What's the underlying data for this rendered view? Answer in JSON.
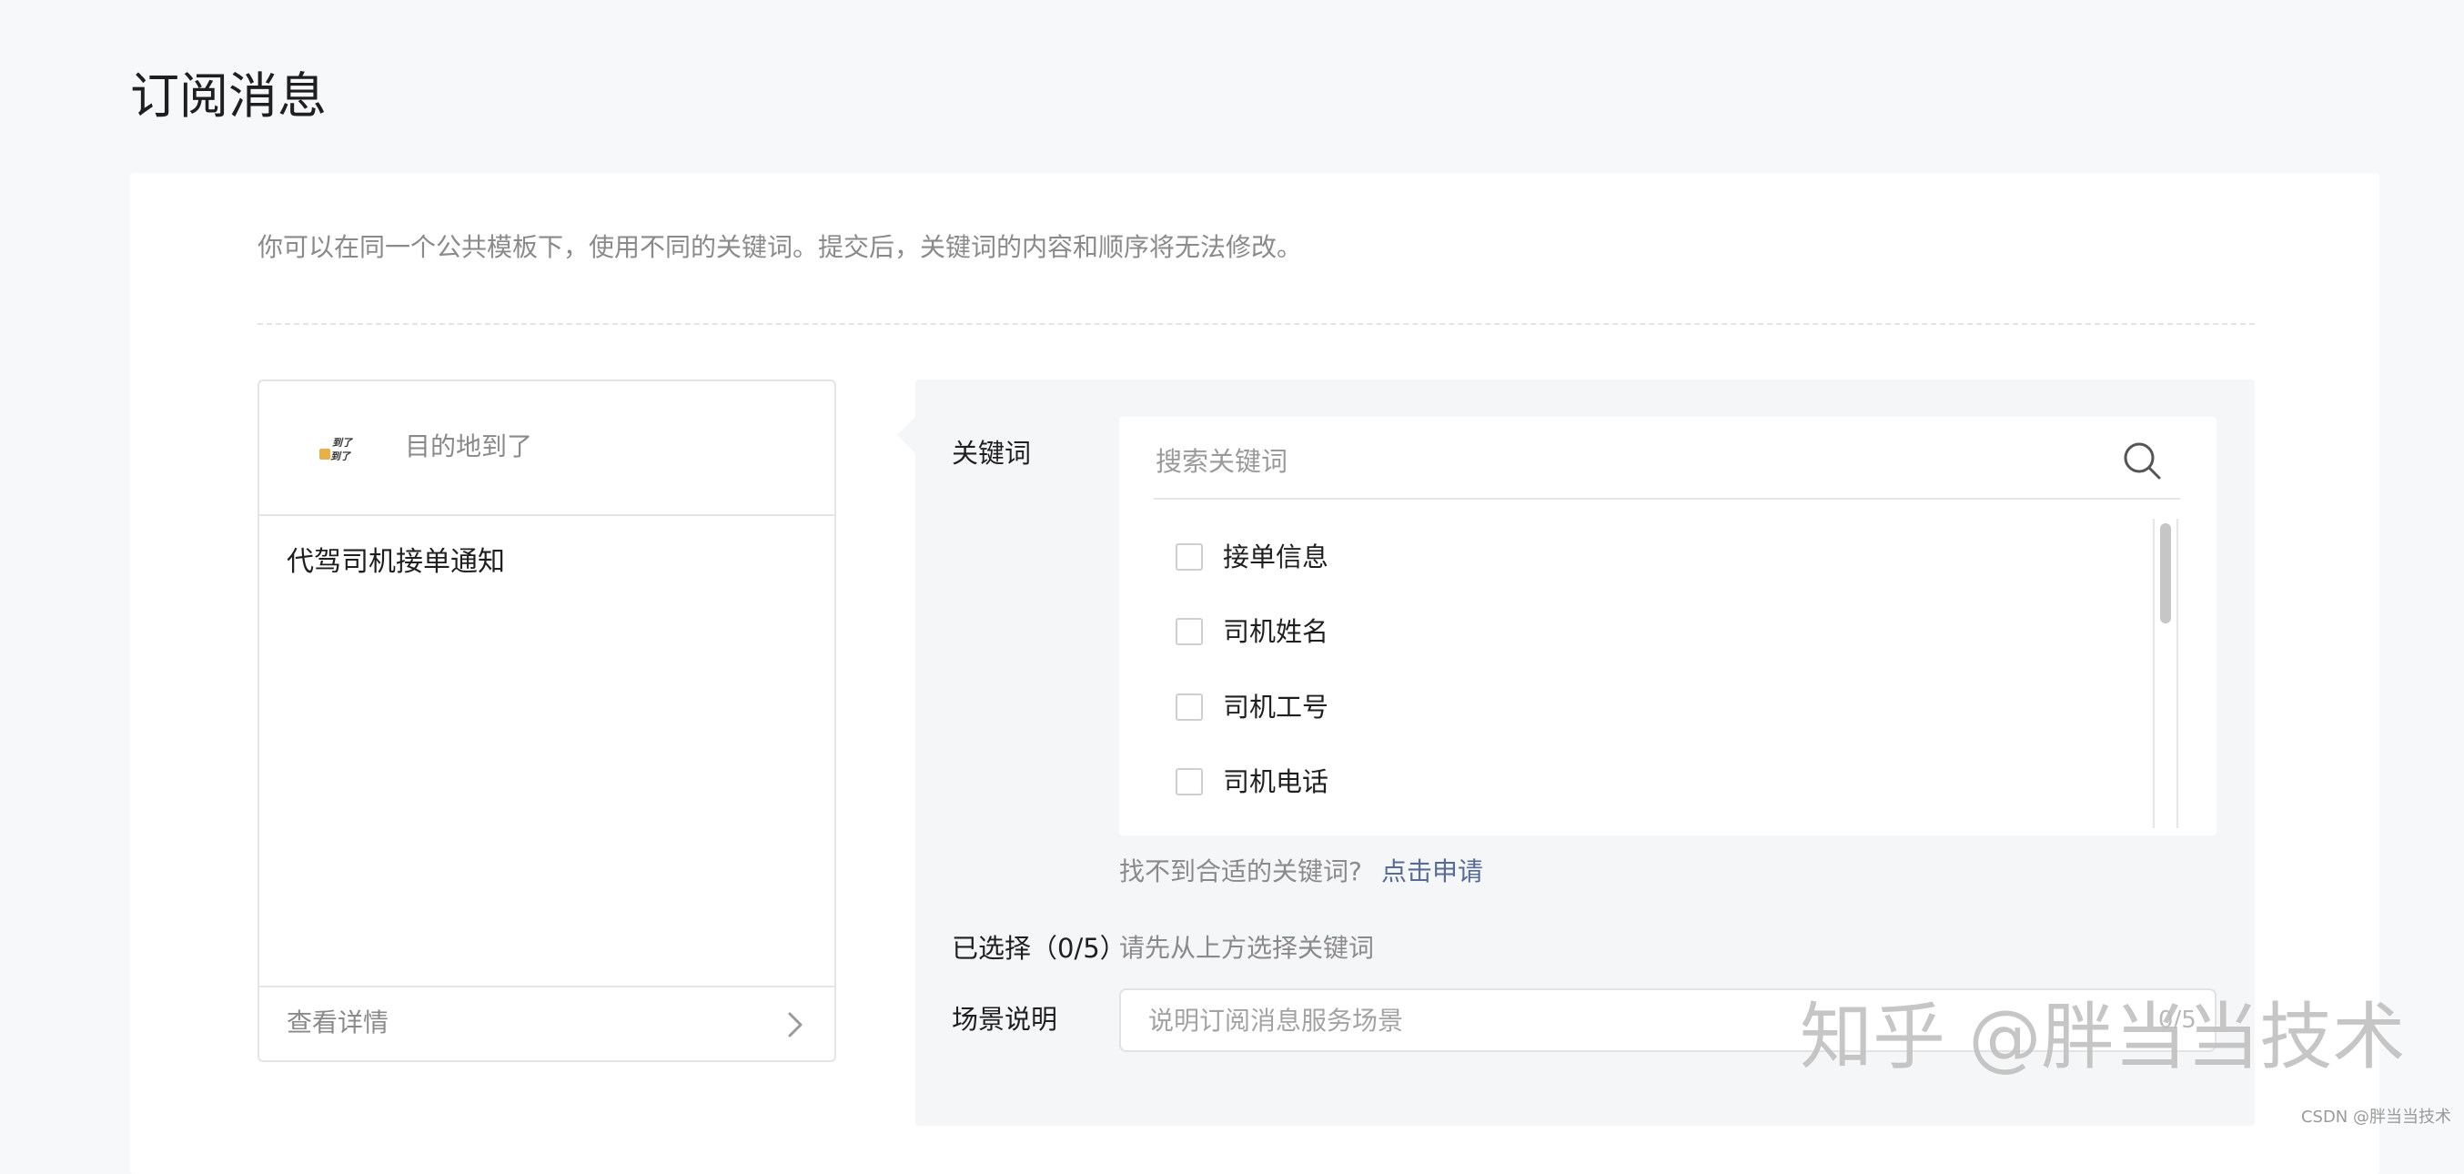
{
  "page": {
    "title": "订阅消息"
  },
  "notice": "你可以在同一个公共模板下，使用不同的关键词。提交后，关键词的内容和顺序将无法修改。",
  "preview": {
    "app_name": "目的地到了",
    "logo_text": "到了到了",
    "message_title": "代驾司机接单通知",
    "footer_label": "查看详情",
    "footer_icon": "chevron-right-icon"
  },
  "keywords": {
    "label": "关键词",
    "search_placeholder": "搜索关键词",
    "search_icon": "search-icon",
    "items": [
      {
        "label": "接单信息",
        "checked": false
      },
      {
        "label": "司机姓名",
        "checked": false
      },
      {
        "label": "司机工号",
        "checked": false
      },
      {
        "label": "司机电话",
        "checked": false
      }
    ],
    "hint": "找不到合适的关键词?",
    "apply_link": "点击申请"
  },
  "selected": {
    "label": "已选择（0/5）",
    "hint": "请先从上方选择关键词"
  },
  "scene": {
    "label": "场景说明",
    "placeholder": "说明订阅消息服务场景",
    "count": "0/5"
  },
  "watermark": "知乎 @胖当当技术",
  "credit": "CSDN @胖当当技术",
  "colors": {
    "background": "#f7f8fa",
    "card": "#ffffff",
    "panel": "#f5f6f7",
    "link": "#576b95",
    "muted_text": "#8a8a8a"
  }
}
